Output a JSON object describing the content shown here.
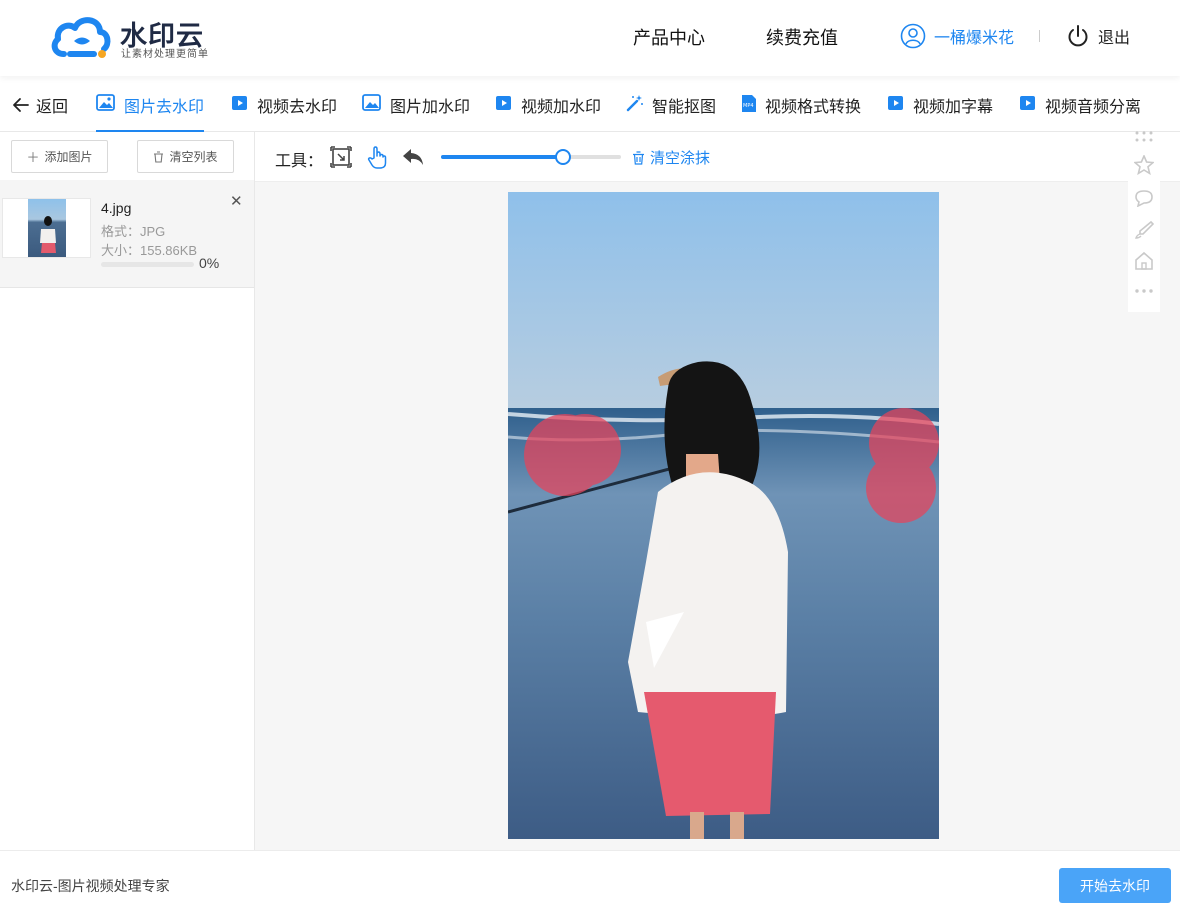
{
  "brand": {
    "name": "水印云",
    "slogan": "让素材处理更简单",
    "colors": {
      "primary": "#1e86f0",
      "button": "#4aa4f8",
      "logo_dot": "#f5a623",
      "mask": "#e8435a"
    }
  },
  "header": {
    "nav": [
      "产品中心",
      "续费充值"
    ],
    "user_name": "一桶爆米花",
    "user_icon": "user-circle-icon",
    "logout_label": "退出",
    "logout_icon": "power-icon"
  },
  "tools_nav": {
    "back_label": "返回",
    "tabs": [
      {
        "label": "图片去水印",
        "icon": "image-icon",
        "active": true
      },
      {
        "label": "视频去水印",
        "icon": "video-icon",
        "active": false
      },
      {
        "label": "图片加水印",
        "icon": "image-add-icon",
        "active": false
      },
      {
        "label": "视频加水印",
        "icon": "video-add-icon",
        "active": false
      },
      {
        "label": "智能抠图",
        "icon": "magic-wand-icon",
        "active": false
      },
      {
        "label": "视频格式转换",
        "icon": "mp4-file-icon",
        "active": false
      },
      {
        "label": "视频加字幕",
        "icon": "video-subtitle-icon",
        "active": false
      },
      {
        "label": "视频音频分离",
        "icon": "video-audio-icon",
        "active": false
      }
    ]
  },
  "left_panel": {
    "add_label": "添加图片",
    "clear_label": "清空列表",
    "files": [
      {
        "name": "4.jpg",
        "format": "格式：JPG",
        "size": "大小：155.86KB",
        "progress_percent": 0,
        "progress_label": "0%"
      }
    ]
  },
  "toolbar": {
    "label": "工具：",
    "tools": [
      "select-rect-icon",
      "hand-pointer-icon",
      "undo-icon"
    ],
    "brush_size_fraction": 0.68,
    "clear_label": "清空涂抹"
  },
  "right_rail": [
    "grid-dots-icon",
    "star-icon",
    "comment-icon",
    "brush-icon",
    "home-icon",
    "more-icon"
  ],
  "footer": {
    "text": "水印云-图片视频处理专家",
    "start_label": "开始去水印"
  }
}
